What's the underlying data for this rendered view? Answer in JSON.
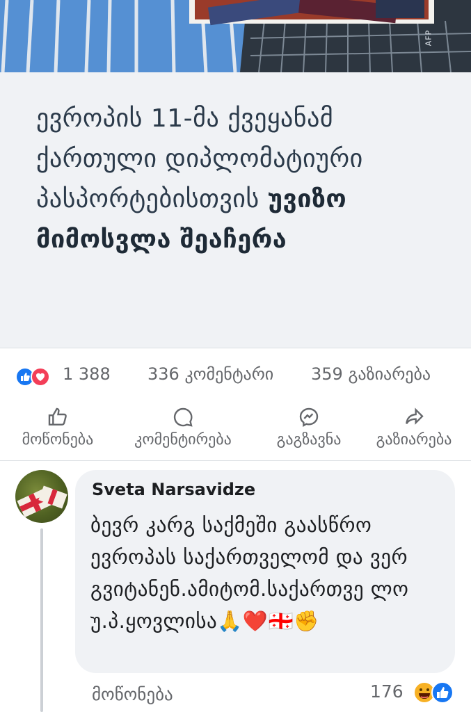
{
  "hero": {
    "photo_credit": "AFP"
  },
  "headline": {
    "part1": "ევროპის 11-მა ქვეყანამ ქართული დიპლომატიური პასპორტებისთვის ",
    "part2": "უვიზო მიმოსვლა შეაჩერა"
  },
  "stats": {
    "reaction_icons": [
      "like-reaction",
      "love-reaction"
    ],
    "reaction_count": "1 388",
    "comments": "336 კომენტარი",
    "shares": "359 გაზიარება"
  },
  "actions": [
    {
      "icon": "thumbs-up-icon",
      "label": "მოწონება"
    },
    {
      "icon": "comment-icon",
      "label": "კომენტირება"
    },
    {
      "icon": "messenger-icon",
      "label": "გაგზავნა"
    },
    {
      "icon": "share-icon",
      "label": "გაზიარება"
    }
  ],
  "comment": {
    "author": "Sveta Narsavidze",
    "text": "ბევრ კარგ საქმეში გაასწრო ევროპას საქართველომ და ვერ გვიტანენ.ამიტომ.საქართვე ლო უ.პ.ყოვლისა🙏❤️🇬🇪✊",
    "like_label": "მოწონება",
    "reaction_count": "176",
    "reaction_icons": [
      "haha-reaction",
      "like-reaction"
    ]
  },
  "colors": {
    "accent": "#1877f2",
    "love": "#f33e58",
    "haha": "#f7b125",
    "muted": "#65676b"
  }
}
